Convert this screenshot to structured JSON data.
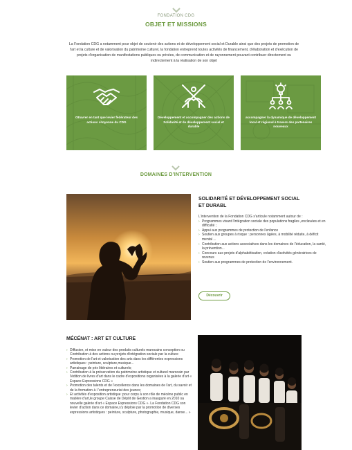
{
  "header": {
    "kicker": "FONDATION CDG",
    "title": "OBJET ET MISSIONS",
    "intro": "La Fondation CDG a notamment pour objet de soutenir des actions et de développement social et Durable ainsi que des projets de promotion de l'art et la culture et de valorisation du patrimoine culturel, la fondation entreprend toutes activités de financement, d'élaboration et d'exécution de projets d'organisation de manifestations publiques ou privées, de communication et de rayonnement pouvant contribuer directement ou indirectement à la réalisation de son objet"
  },
  "cards": [
    {
      "caption": "OEuvrer en tant que levier fédérateur des actions citoyenne du CDG",
      "icon": "handshake-icon"
    },
    {
      "caption": "Développement et accompagner des actions de Solidarité et de développement social et durable",
      "icon": "hands-holding-icon"
    },
    {
      "caption": "accompagner la dynamique de développement local et régional à travers des partenaires nouveaux",
      "icon": "network-lightbulb-icon"
    }
  ],
  "section2": {
    "title": "DOMAINES D’INTERVENTION"
  },
  "solidarite": {
    "title": "SOLIDARITÉ ET DÉVELOPPEMENT SOCIAL ET DURABL",
    "intro": "L'intervention de la Fondation CDG s'articule notamment autour de :",
    "items": [
      "Programmes visant l'intégration sociale des populations fragiles ,enclavées et en difficulté ;",
      "Appui aux programmes de protection de l'enfance",
      "Soutien aux groupes à risque : personnes âgées, à mobilité réduite, à déficit mental ...",
      "Contribution aux actions associatives dans les domaines de l'éducation, la santé, la prévention...",
      "Concours aux projets d'alphabétisation, création d'activités génératrices de revenus",
      "Soutien aux programmes de protection de l'environnement."
    ],
    "button": "Découvrir"
  },
  "mecenat": {
    "title": "MÉCÉNAT : ART ET CULTURE",
    "items": [
      "Diffusion, et mise en valeur des produits culturels marocains conception ou Contribution à des actions ou projets d'intégration sociale par la culture",
      "Promotion de l'art et valorisation des arts dans les différentes expressions artistiques : peinture, sculpture,musique...",
      "Parrainage de prix littéraires et culturels;",
      "Contribution à la préservation du patrimoine artistique et culturel marocain par l'édition de livres d'art dans le cadre d'expositions organisées à la galerie d'art « Espace Expressions CDG »",
      "Promotion des talents et de l'excellence dans les domaines de l'art, du savoir et de la formation à l 'entrepreneuriat des jeunes;",
      "Et activités d'exposition artistique :pour corps à son rôle de mécène public en matière d'art,le groupe Caisse de Dépôt de Gestion a inauguré en 2010 sa nouvelle galerie d'art « Espace Expressions CDG ». La Fondation CDG son levier d'action dans ce domaine,s'y déploie par la promotion de diverses expressions artistiques : peinture, sculpture, photographie, musique, danse... »"
    ]
  },
  "colors": {
    "accent": "#6c9a3f",
    "card": "#6b9a42"
  }
}
